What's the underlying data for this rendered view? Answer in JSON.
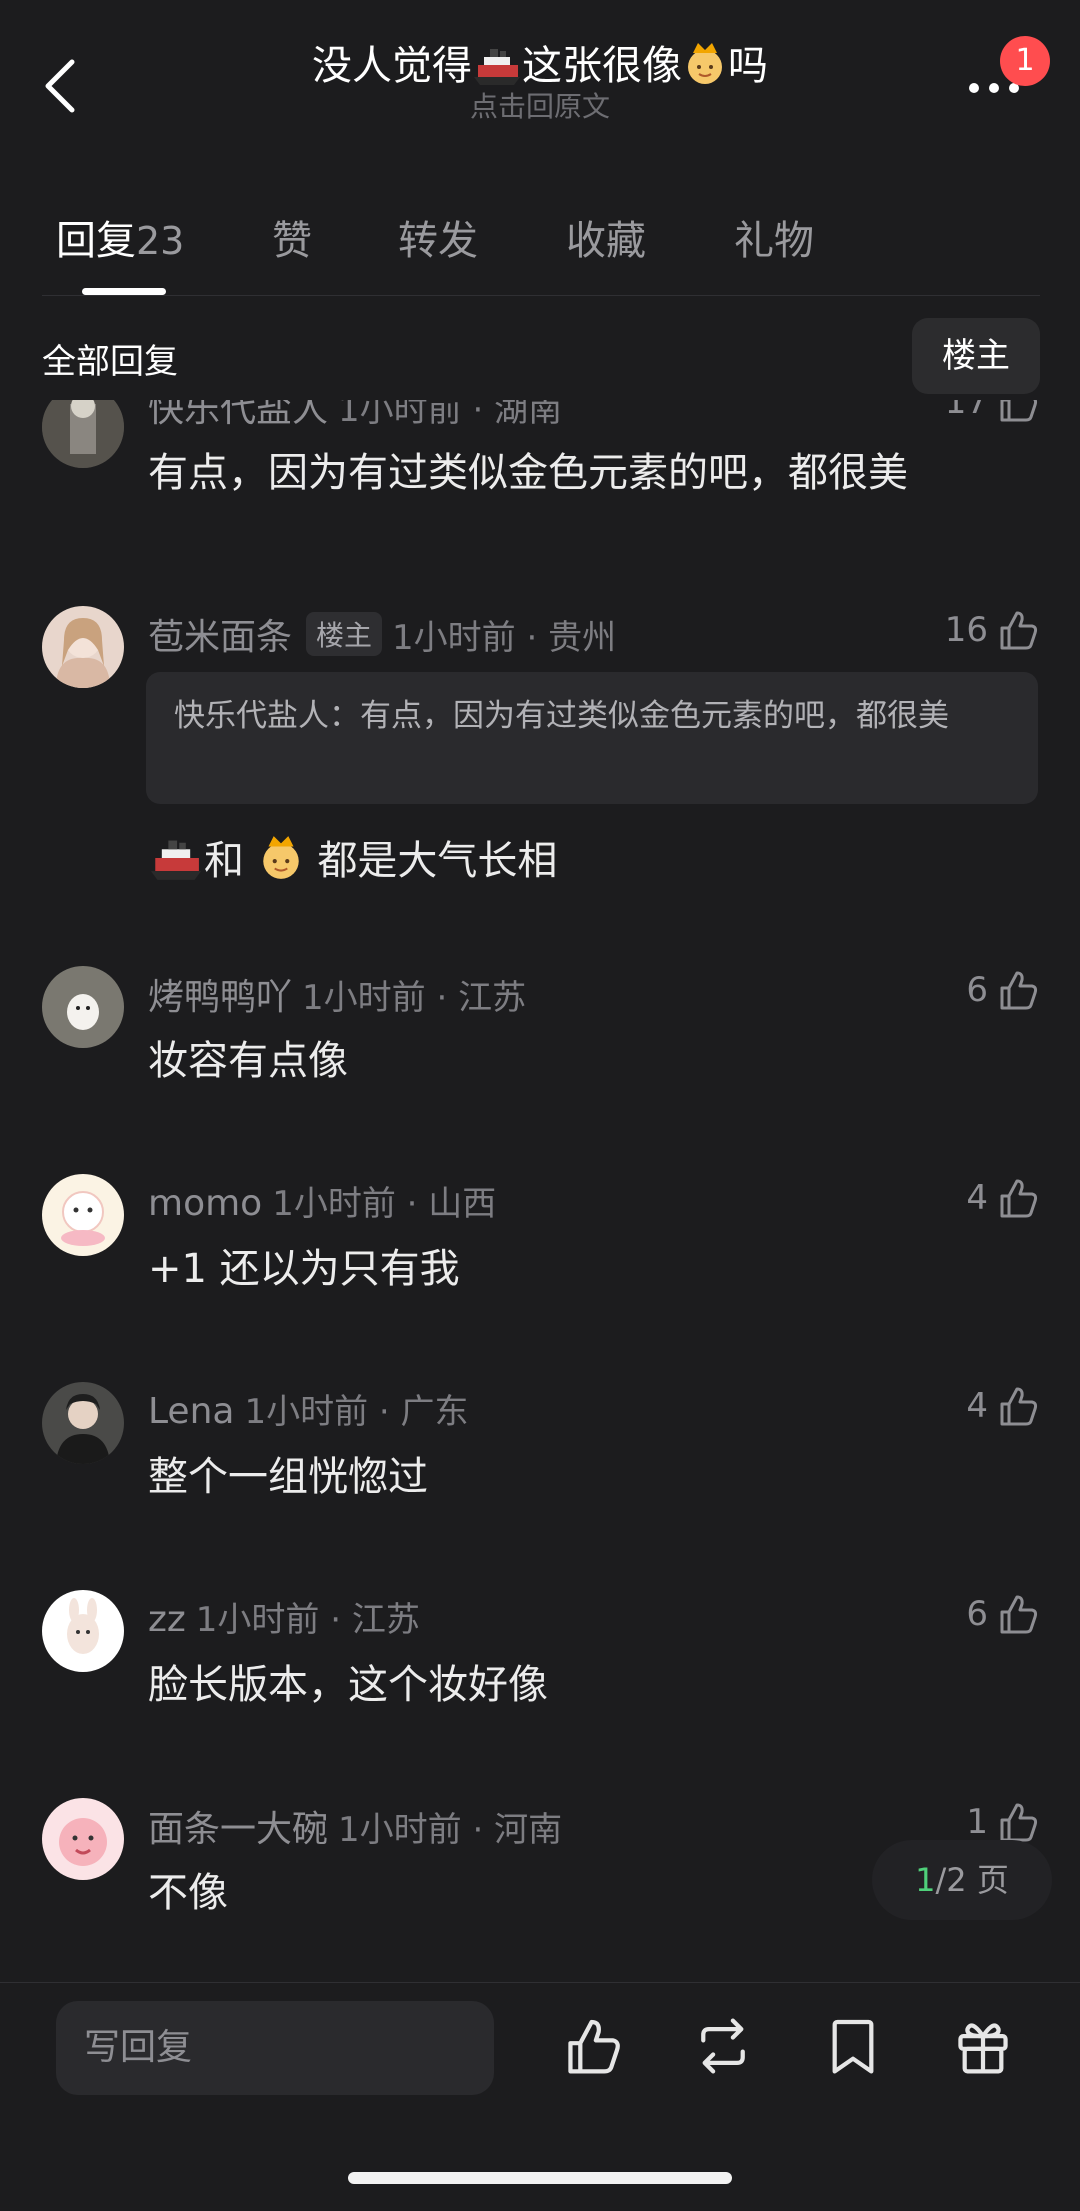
{
  "header": {
    "title_part1": "没人觉得",
    "title_part2": "这张很像",
    "title_part3": "吗",
    "subtitle": "点击回原文",
    "notification_count": "1"
  },
  "tabs": [
    {
      "label": "回复",
      "count": "23",
      "active": true
    },
    {
      "label": "赞"
    },
    {
      "label": "转发"
    },
    {
      "label": "收藏"
    },
    {
      "label": "礼物"
    }
  ],
  "filter": {
    "label": "全部回复",
    "op_button": "楼主"
  },
  "comments": [
    {
      "name": "快乐代盐人",
      "time": "1小时前 · 湖南",
      "likes": "17",
      "text": "有点，因为有过类似金色元素的吧，都很美"
    },
    {
      "name": "苞米面条",
      "tag": "楼主",
      "time": "1小时前 · 贵州",
      "likes": "16",
      "quote": "快乐代盐人：有点，因为有过类似金色元素的吧，都很美",
      "text_mid": "和",
      "text_end": "都是大气长相"
    },
    {
      "name": "烤鸭鸭吖",
      "time": "1小时前 · 江苏",
      "likes": "6",
      "text": "妆容有点像"
    },
    {
      "name": "momo",
      "time": "1小时前 · 山西",
      "likes": "4",
      "text": "+1 还以为只有我"
    },
    {
      "name": "Lena",
      "time": "1小时前 · 广东",
      "likes": "4",
      "text": "整个一组恍惚过"
    },
    {
      "name": "zz",
      "time": "1小时前 · 江苏",
      "likes": "6",
      "text": "脸长版本，这个妆好像"
    },
    {
      "name": "面条一大碗",
      "time": "1小时前 · 河南",
      "likes": "1",
      "text": "不像"
    }
  ],
  "pager": {
    "current": "1",
    "rest": "/2 页"
  },
  "bottom": {
    "reply_placeholder": "写回复"
  },
  "colors": {
    "background": "#1c1c1e",
    "accent_green": "#4fd07a",
    "badge_red": "#ff4d4f"
  },
  "icons": [
    "back-arrow-icon",
    "more-dots-icon",
    "thumbs-up-icon",
    "repost-icon",
    "bookmark-icon",
    "gift-icon",
    "ship-emoji-icon",
    "princess-emoji-icon"
  ]
}
